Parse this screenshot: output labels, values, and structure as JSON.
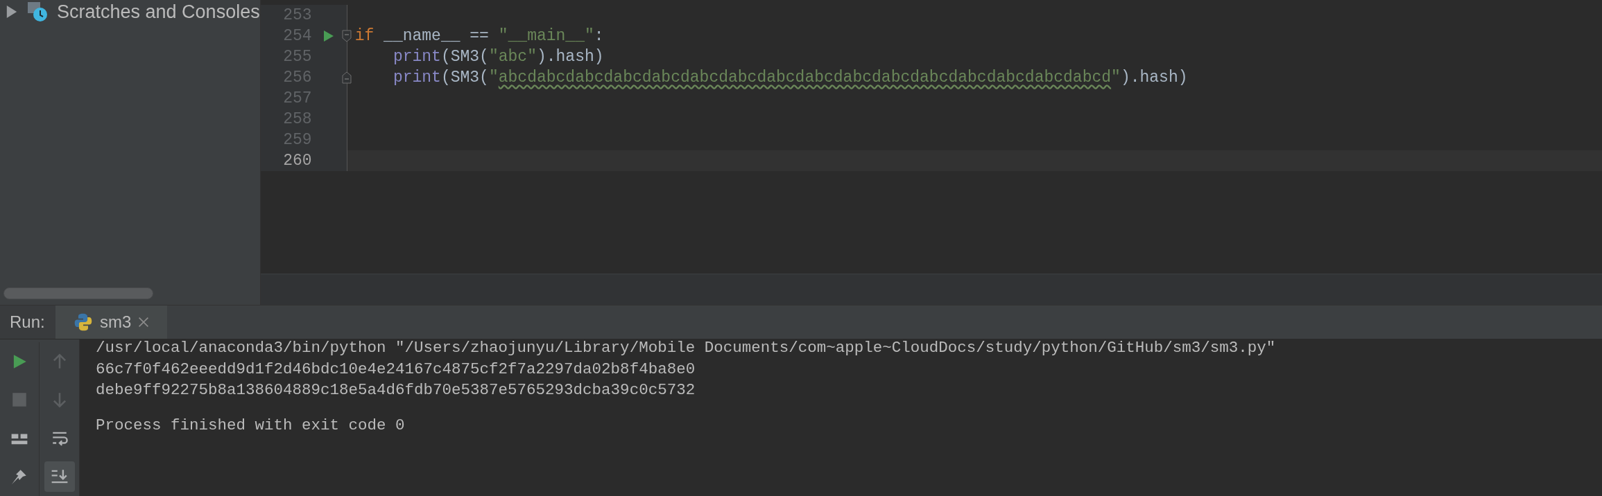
{
  "project_tree": {
    "items": [
      {
        "label": "Scratches and Consoles",
        "expanded": false
      }
    ]
  },
  "editor": {
    "lines": [
      {
        "number": "253",
        "current": false,
        "run_marker": false,
        "fold_start": false,
        "fold_end": false
      },
      {
        "number": "254",
        "current": false,
        "run_marker": true,
        "fold_start": true,
        "fold_end": false,
        "tokens": [
          {
            "kind": "keyword",
            "text": "if"
          },
          {
            "kind": "plain",
            "text": " __name__ == "
          },
          {
            "kind": "string",
            "text": "\"__main__\""
          },
          {
            "kind": "plain",
            "text": ":"
          }
        ]
      },
      {
        "number": "255",
        "current": false,
        "run_marker": false,
        "fold_start": false,
        "fold_end": false,
        "tokens": [
          {
            "kind": "builtin",
            "text": "    print"
          },
          {
            "kind": "plain",
            "text": "(SM3("
          },
          {
            "kind": "string",
            "text": "\"abc\""
          },
          {
            "kind": "plain",
            "text": ").hash)"
          }
        ]
      },
      {
        "number": "256",
        "current": false,
        "run_marker": false,
        "fold_start": false,
        "fold_end": true,
        "tokens": [
          {
            "kind": "builtin",
            "text": "    print"
          },
          {
            "kind": "plain",
            "text": "(SM3("
          },
          {
            "kind": "string",
            "text": "\""
          },
          {
            "kind": "typo",
            "text": "abcdabcdabcdabcdabcdabcdabcdabcdabcdabcdabcdabcdabcdabcdabcdabcd"
          },
          {
            "kind": "string",
            "text": "\""
          },
          {
            "kind": "plain",
            "text": ").hash)"
          }
        ]
      },
      {
        "number": "257",
        "current": false,
        "run_marker": false,
        "fold_start": false,
        "fold_end": false
      },
      {
        "number": "258",
        "current": false,
        "run_marker": false,
        "fold_start": false,
        "fold_end": false
      },
      {
        "number": "259",
        "current": false,
        "run_marker": false,
        "fold_start": false,
        "fold_end": false
      },
      {
        "number": "260",
        "current": true,
        "run_marker": false,
        "fold_start": false,
        "fold_end": false
      }
    ]
  },
  "run_panel": {
    "label": "Run:",
    "tabs": [
      {
        "label": "sm3",
        "selected": true,
        "closable": true
      }
    ],
    "toolbar": [
      {
        "kind": "run",
        "disabled": false,
        "selected": false
      },
      {
        "kind": "up",
        "disabled": true,
        "selected": false
      },
      {
        "kind": "stop",
        "disabled": true,
        "selected": false
      },
      {
        "kind": "down",
        "disabled": true,
        "selected": false
      },
      {
        "kind": "layout",
        "disabled": false,
        "selected": false
      },
      {
        "kind": "wrap",
        "disabled": false,
        "selected": false
      },
      {
        "kind": "pin",
        "disabled": false,
        "selected": false
      },
      {
        "kind": "scroll_end",
        "disabled": false,
        "selected": true
      }
    ],
    "console": [
      {
        "kind": "command",
        "text": "/usr/local/anaconda3/bin/python \"/Users/zhaojunyu/Library/Mobile Documents/com~apple~CloudDocs/study/python/GitHub/sm3/sm3.py\""
      },
      {
        "kind": "output",
        "text": "66c7f0f462eeedd9d1f2d46bdc10e4e24167c4875cf2f7a2297da02b8f4ba8e0"
      },
      {
        "kind": "output",
        "text": "debe9ff92275b8a138604889c18e5a4d6fdb70e5387e5765293dcba39c0c5732"
      },
      {
        "kind": "status",
        "text": "Process finished with exit code 0"
      }
    ]
  }
}
